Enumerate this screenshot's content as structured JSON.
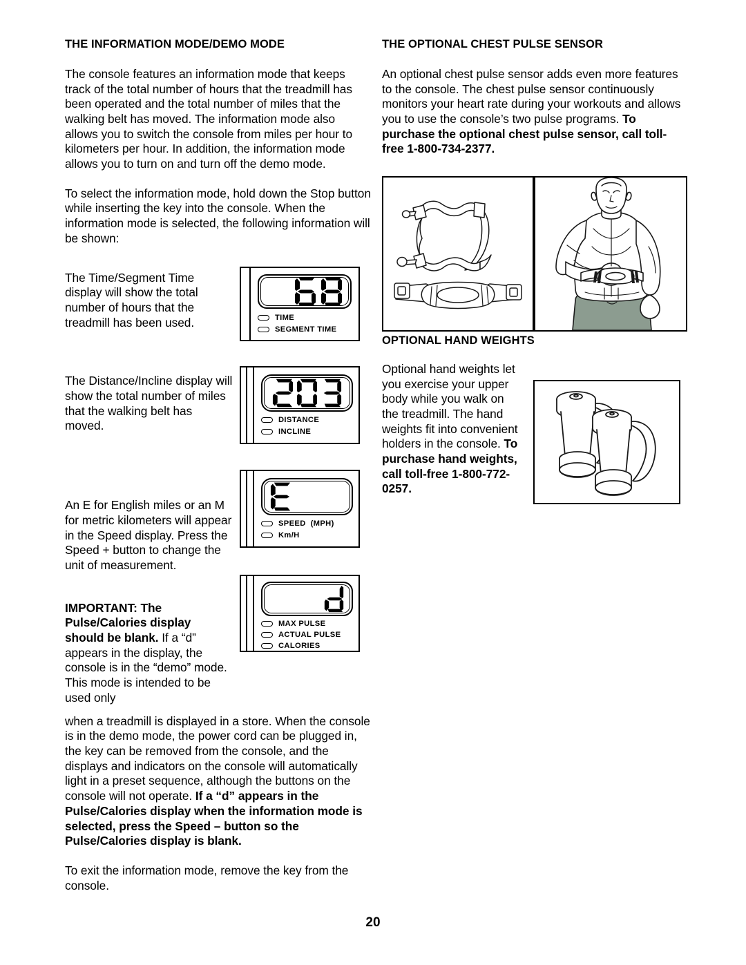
{
  "page": {
    "number": "20"
  },
  "left_column": {
    "heading": "THE INFORMATION MODE/DEMO MODE",
    "para1": "The console features an information mode that keeps track of the total number of hours that the treadmill has been operated and the total number of miles that the walking belt has moved. The information mode also allows you to switch the console from miles per hour to kilometers per hour. In addition, the information mode allows you to turn on and turn off the demo mode.",
    "para2": "To select the information mode, hold down the Stop button while inserting the key into the console. When the information mode is selected, the following information will be shown:",
    "para3": "The Time/Segment Time display will show the total number of hours that the treadmill has been used.",
    "para4": "The Distance/Incline display will show the total number of miles that the walking belt has moved.",
    "para5": "An E for English miles or an M for metric kilometers will appear in the Speed display. Press the Speed + button to change the unit of measurement.",
    "para6_bold": "IMPORTANT: The Pulse/Calories display should be blank.",
    "para6_rest": " If a “d” appears in the display, the console is in the “demo” mode. This mode is intended to be used only",
    "para7_rest": "when a treadmill is displayed in a store. When the console is in the demo mode, the power cord can be plugged in, the key can be removed from the console, and the displays and indicators on the console will automatically light in a preset sequence, although the buttons on the console will not operate. ",
    "para7_bold": "If a “d” appears in the Pulse/Calories display when the information mode is selected, press the Speed – button so the Pulse/Calories display is blank.",
    "para8": "To exit the information mode, remove the key from the console."
  },
  "right_column": {
    "heading1": "THE OPTIONAL CHEST PULSE SENSOR",
    "para1_rest": "An optional chest pulse sensor adds even more features to the console. The chest pulse sensor continuously monitors your heart rate during your workouts and allows you to use the console’s two pulse programs. ",
    "para1_bold": "To purchase the optional chest pulse sensor, call toll-free 1-800-734-2377.",
    "heading2": "OPTIONAL HAND WEIGHTS",
    "para2_rest": "Optional hand weights let you exercise your upper body while you walk on the treadmill. The hand weights fit into convenient holders in the console. ",
    "para2_bold": "To purchase hand weights, call toll-free 1-800-772-0257."
  },
  "displays": [
    {
      "id": "time-segment-time",
      "value": "68",
      "align": "right",
      "indicators": [
        "TIME",
        "SEGMENT TIME"
      ]
    },
    {
      "id": "distance-incline",
      "value": "203",
      "align": "center",
      "indicators": [
        "DISTANCE",
        "INCLINE"
      ]
    },
    {
      "id": "speed",
      "value": "E",
      "align": "left",
      "indicators": [
        "SPEED  (MPH)",
        "Km/H"
      ]
    },
    {
      "id": "pulse-calories",
      "value": "d",
      "align": "right",
      "indicators": [
        "MAX PULSE",
        "ACTUAL PULSE",
        "CALORIES"
      ]
    }
  ],
  "figures": {
    "chest_strap": "chest-pulse-sensor-strap-illustration",
    "man_wearing": "man-wearing-chest-strap-illustration",
    "hand_weights": "hand-weights-illustration"
  },
  "colors": {
    "ink": "#000000",
    "paper": "#ffffff",
    "shorts": "#8c9c90",
    "shade": "#d9d9d9"
  }
}
